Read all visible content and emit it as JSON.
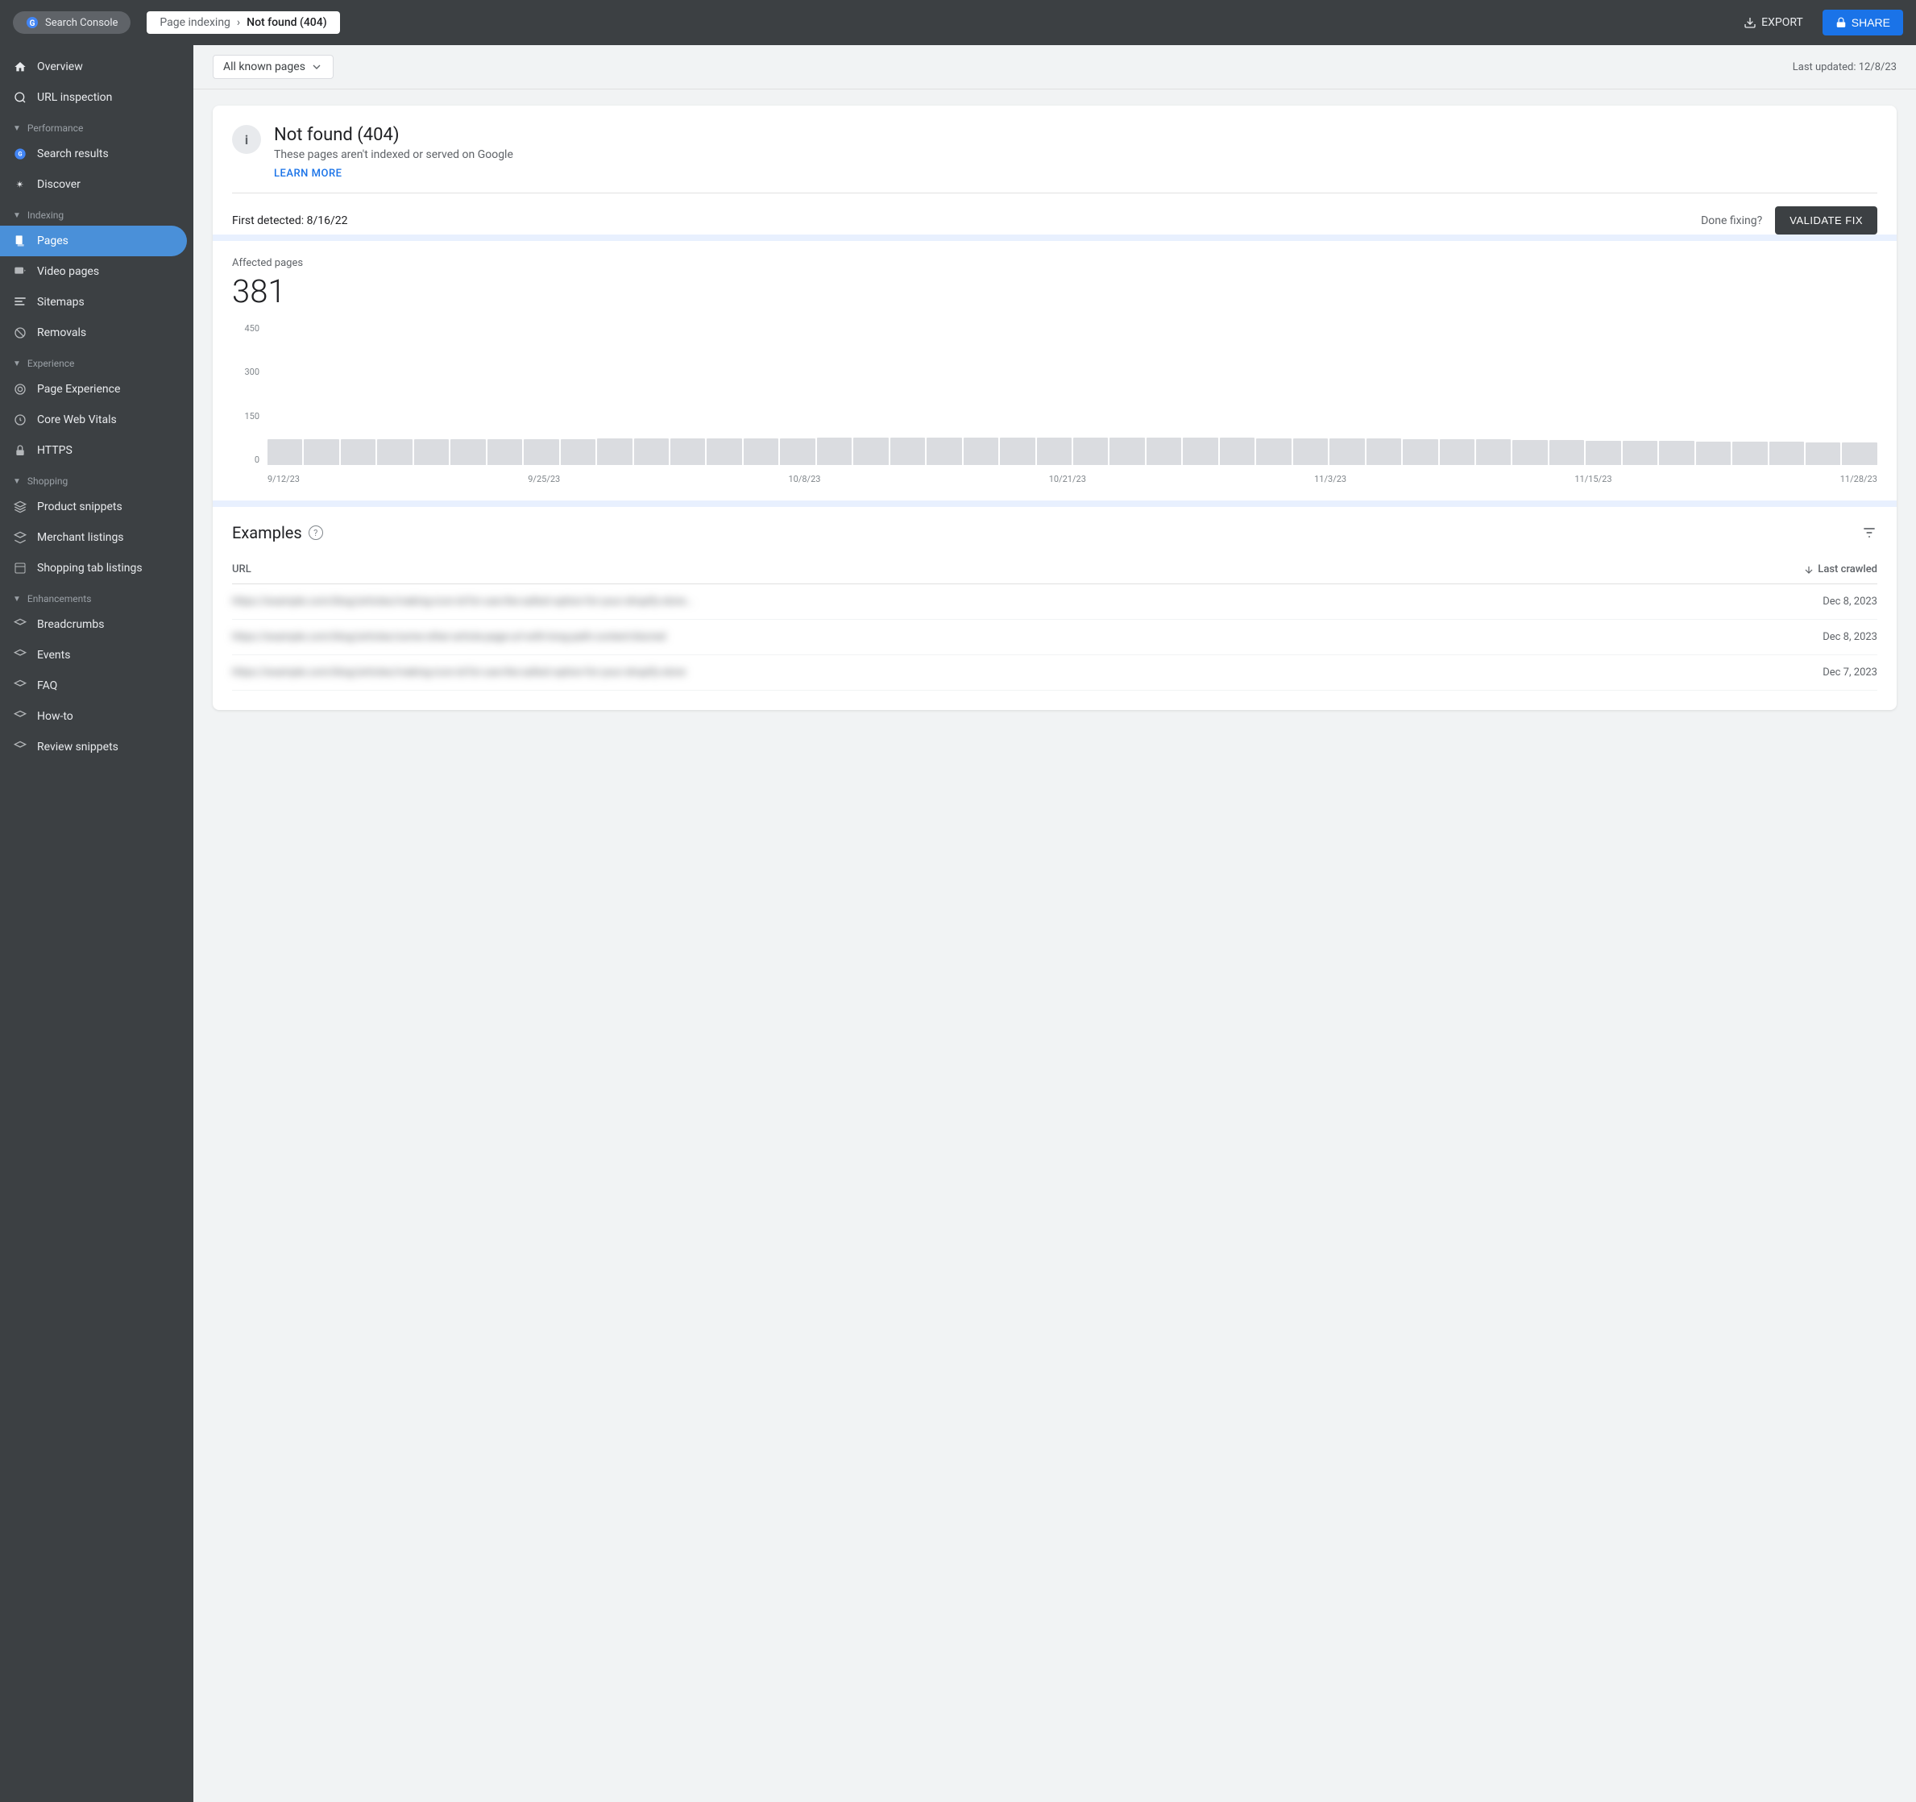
{
  "topbar": {
    "logo_text": "Search Console",
    "breadcrumb_parent": "Page indexing",
    "breadcrumb_separator": "›",
    "breadcrumb_current": "Not found (404)",
    "export_label": "EXPORT",
    "share_label": "SHARE"
  },
  "sub_header": {
    "filter_label": "All known pages",
    "last_updated_label": "Last updated: 12/8/23"
  },
  "sidebar": {
    "overview": "Overview",
    "url_inspection": "URL inspection",
    "performance_section": "Performance",
    "search_results": "Search results",
    "discover": "Discover",
    "indexing_section": "Indexing",
    "pages": "Pages",
    "video_pages": "Video pages",
    "sitemaps": "Sitemaps",
    "removals": "Removals",
    "experience_section": "Experience",
    "page_experience": "Page Experience",
    "core_web_vitals": "Core Web Vitals",
    "https": "HTTPS",
    "shopping_section": "Shopping",
    "product_snippets": "Product snippets",
    "merchant_listings": "Merchant listings",
    "shopping_tab_listings": "Shopping tab listings",
    "enhancements_section": "Enhancements",
    "breadcrumbs": "Breadcrumbs",
    "events": "Events",
    "faq": "FAQ",
    "howto": "How-to",
    "review_snippets": "Review snippets"
  },
  "alert": {
    "title": "Not found (404)",
    "subtitle": "These pages aren't indexed or served on Google",
    "learn_more": "LEARN MORE",
    "first_detected_label": "First detected:",
    "first_detected_date": "8/16/22",
    "done_fixing_label": "Done fixing?",
    "validate_fix_label": "VALIDATE FIX"
  },
  "stats": {
    "affected_label": "Affected pages",
    "affected_count": "381"
  },
  "chart": {
    "y_labels": [
      "450",
      "300",
      "150",
      "0"
    ],
    "x_labels": [
      "9/12/23",
      "9/25/23",
      "10/8/23",
      "10/21/23",
      "11/3/23",
      "11/15/23",
      "11/28/23"
    ],
    "bars": [
      82,
      82,
      82,
      82,
      82,
      82,
      82,
      82,
      82,
      82,
      82,
      82,
      82,
      83,
      83,
      84,
      84,
      84,
      84,
      85,
      85,
      84,
      84,
      84,
      84,
      84,
      83,
      83,
      83,
      83,
      82,
      81,
      80,
      79,
      78,
      77,
      76,
      75,
      74,
      73,
      72,
      71,
      70,
      69
    ]
  },
  "examples": {
    "title": "Examples",
    "col_url": "URL",
    "col_date": "Last crawled",
    "rows": [
      {
        "url": "████████████████████████████████████████████████",
        "date": "Dec 8, 2023"
      },
      {
        "url": "████████████████████████████████████████████████",
        "date": "Dec 8, 2023"
      },
      {
        "url": "████████████████████████████████████████████████",
        "date": "Dec 7, 2023"
      }
    ]
  }
}
